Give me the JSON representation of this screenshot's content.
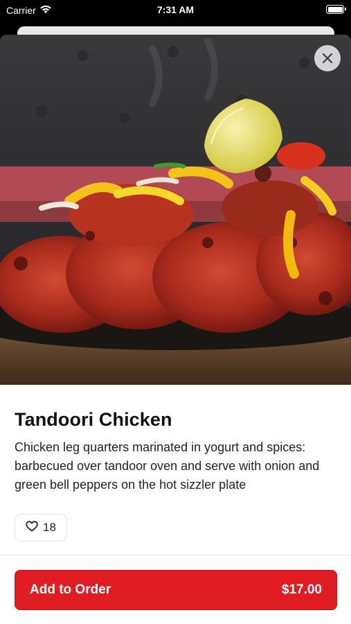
{
  "status_bar": {
    "carrier": "Carrier",
    "time": "7:31 AM"
  },
  "modal": {
    "close_icon": "close-icon",
    "hero_image": "tandoori-chicken-photo"
  },
  "dish": {
    "title": "Tandoori Chicken",
    "description": "Chicken leg quarters marinated in yogurt and spices: barbecued over tandoor oven and serve with onion and green bell peppers on the hot sizzler plate",
    "like_count": "18",
    "like_icon": "heart-icon"
  },
  "order": {
    "label": "Add to Order",
    "price": "$17.00"
  },
  "colors": {
    "accent": "#e01d22"
  }
}
